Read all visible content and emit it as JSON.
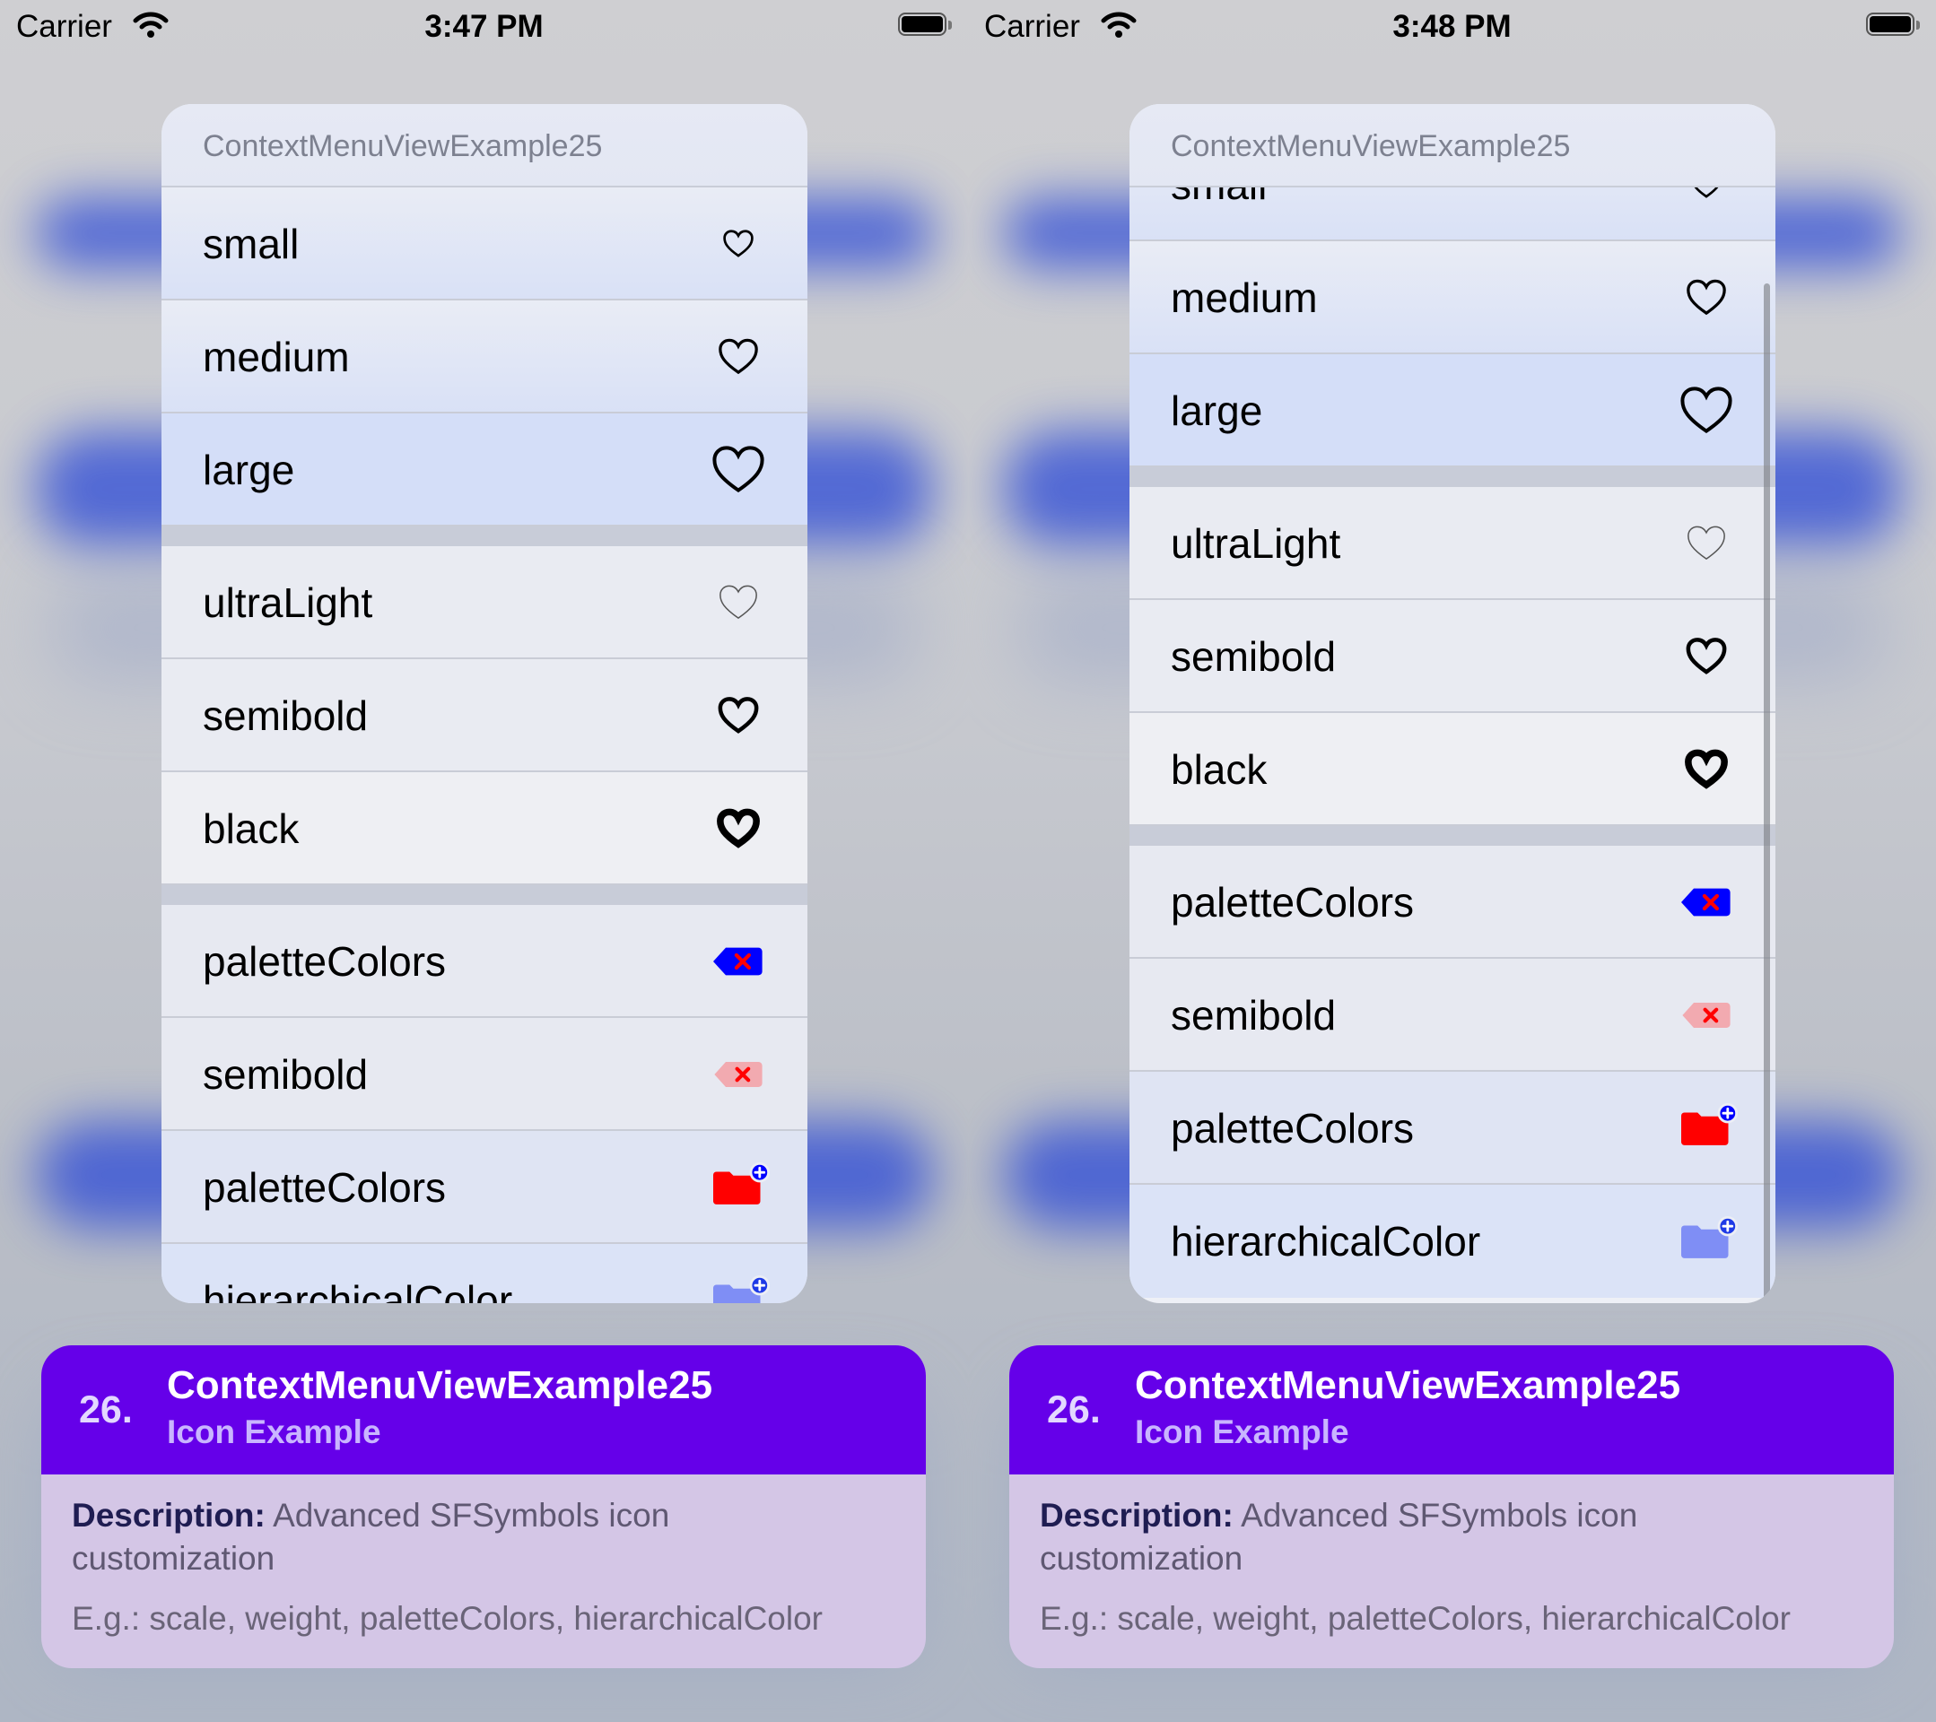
{
  "status_left": {
    "carrier": "Carrier",
    "time": "3:47 PM"
  },
  "status_right": {
    "carrier": "Carrier",
    "time": "3:48 PM"
  },
  "menu": {
    "title": "ContextMenuViewExample25",
    "groups": [
      {
        "items": [
          {
            "label": "small",
            "icon": "heart-icon-small"
          },
          {
            "label": "medium",
            "icon": "heart-icon-medium"
          },
          {
            "label": "large",
            "icon": "heart-icon-large"
          }
        ]
      },
      {
        "items": [
          {
            "label": "ultraLight",
            "icon": "heart-icon-ultralight"
          },
          {
            "label": "semibold",
            "icon": "heart-icon-semibold"
          },
          {
            "label": "black",
            "icon": "heart-icon-black"
          }
        ]
      },
      {
        "items": [
          {
            "label": "paletteColors",
            "icon": "delete-left-icon-palette"
          },
          {
            "label": "semibold",
            "icon": "delete-left-icon-semibold"
          },
          {
            "label": "paletteColors",
            "icon": "folder-badge-plus-icon-palette"
          },
          {
            "label": "hierarchicalColor",
            "icon": "folder-badge-plus-icon-hierarchical"
          }
        ]
      }
    ]
  },
  "card": {
    "number": "26.",
    "title": "ContextMenuViewExample25",
    "subtitle": "Icon Example",
    "desc_label": "Description:",
    "desc_text": "Advanced SFSymbols icon customization",
    "example": "E.g.: scale, weight, paletteColors, hierarchicalColor"
  },
  "colors": {
    "accent_purple": "#6500e9",
    "palette_blue": "#0000ff",
    "palette_red": "#ff0000",
    "hierarchical_blue": "#6b7cf3"
  }
}
